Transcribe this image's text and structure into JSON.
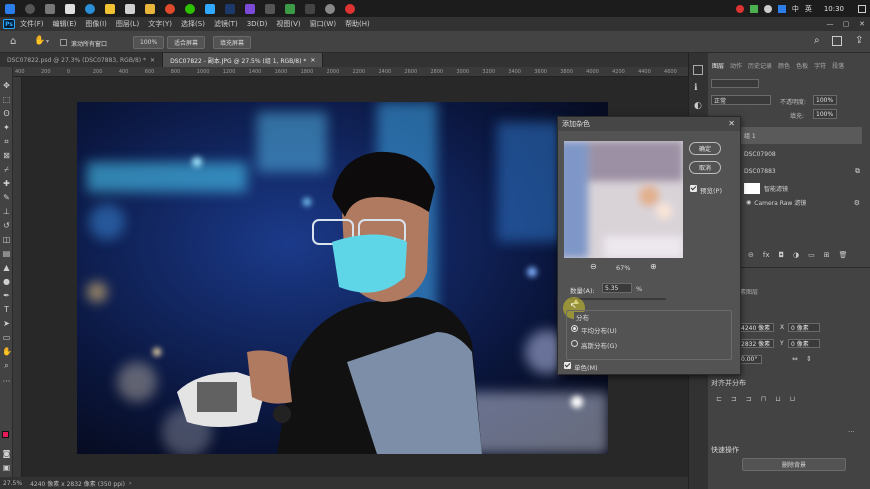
{
  "taskbar": {
    "time": "10:30",
    "ime": "英",
    "ime_mode": "中"
  },
  "menu": {
    "items": [
      "文件(F)",
      "编辑(E)",
      "图像(I)",
      "图层(L)",
      "文字(Y)",
      "选择(S)",
      "滤镜(T)",
      "3D(D)",
      "视图(V)",
      "窗口(W)",
      "帮助(H)"
    ]
  },
  "options": {
    "scroll_all_windows": "滚动所有窗口",
    "zoom_value": "100%",
    "fit_screen": "适合屏幕",
    "fill_screen": "填充屏幕"
  },
  "tabs": [
    {
      "label": "DSC07822.psd @ 27.3% (DSC07883, RGB/8) *"
    },
    {
      "label": "DSC07822 - 副本.JPG @ 27.5% (组 1, RGB/8) *"
    }
  ],
  "ruler": {
    "h": [
      "400",
      "200",
      "0",
      "200",
      "400",
      "600",
      "800",
      "1000",
      "1200",
      "1400",
      "1600",
      "1800",
      "2000",
      "2200",
      "2400",
      "2600",
      "2800",
      "3000",
      "3200",
      "3400",
      "3600",
      "3800",
      "4000",
      "4200",
      "4400",
      "4600"
    ]
  },
  "status": {
    "zoom": "27.5%",
    "doc_info": "4240 像素 x 2832 像素 (350 ppi)"
  },
  "panels": {
    "tabs": [
      "图层",
      "动作",
      "历史记录",
      "颜色",
      "色板",
      "字符",
      "段落"
    ],
    "blend_mode": "正常",
    "opacity_label": "不透明度:",
    "opacity_value": "100%",
    "fill_label": "填充:",
    "fill_value": "100%",
    "layers": [
      {
        "name": "组 1"
      },
      {
        "name": "DSC07908"
      },
      {
        "name": "DSC07883"
      },
      {
        "name": "智能滤镜"
      },
      {
        "name": "Camera Raw 滤镜"
      }
    ],
    "properties": {
      "title": "属性",
      "sub": "像素图层",
      "w_value": "4240 像素",
      "h_value": "2832 像素",
      "x_label": "X",
      "x_value": "0 像素",
      "y_label": "Y",
      "y_value": "0 像素",
      "angle": "0.00°"
    },
    "align_title": "对齐并分布",
    "quick_title": "快速操作",
    "remove_bg": "删除背景"
  },
  "dialog": {
    "title": "添加杂色",
    "ok": "确定",
    "cancel": "取消",
    "preview": "预览(P)",
    "zoom": "67%",
    "amount_label": "数量(A):",
    "amount_value": "5.35",
    "percent": "%",
    "distribution_title": "分布",
    "uniform": "平均分布(U)",
    "gaussian": "高斯分布(G)",
    "mono": "单色(M)",
    "amount_fraction": 0.06
  },
  "colors": {
    "fg": "#e8195a",
    "bg": "#ffffff",
    "accent": "#31a8ff"
  }
}
